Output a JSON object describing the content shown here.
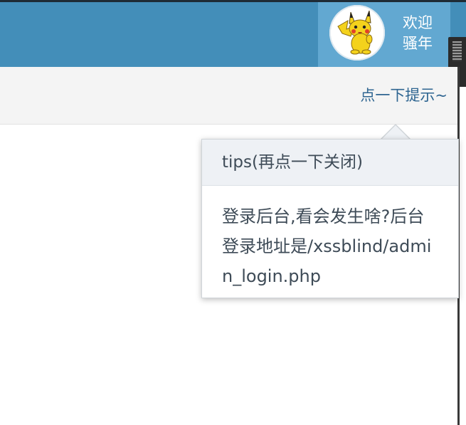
{
  "header": {
    "welcome_line1": "欢迎",
    "welcome_line2": "骚年",
    "avatar_icon": "pikachu-avatar",
    "brand_color": "#438eb9",
    "user_box_color": "#62a8d1"
  },
  "toolbar": {
    "hint_link": "点一下提示~"
  },
  "popover": {
    "title": "tips(再点一下关闭)",
    "body": "登录后台,看会发生啥?后台登录地址是/xssblind/admin_login.php"
  }
}
